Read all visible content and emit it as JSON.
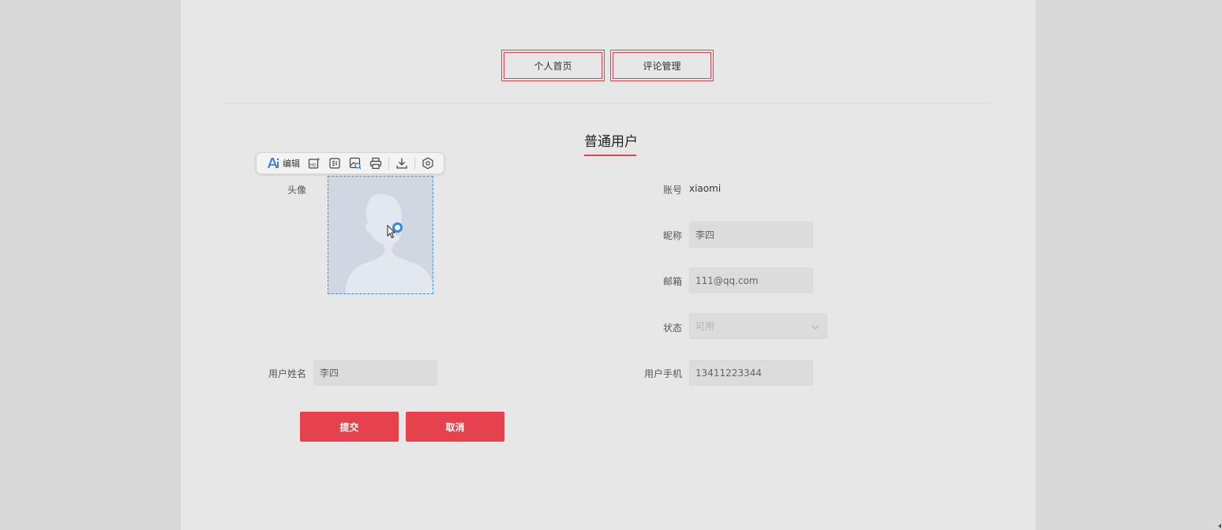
{
  "nav": {
    "home_label": "个人首页",
    "comments_label": "评论管理"
  },
  "section": {
    "title": "普通用户"
  },
  "image_toolbar": {
    "edit_label": "编辑",
    "icons": [
      "ai-edit-icon",
      "hd-icon",
      "ocr-icon",
      "image-search-icon",
      "print-icon",
      "download-icon",
      "settings-icon"
    ]
  },
  "form": {
    "avatar_label": "头像",
    "account_label": "账号",
    "account_value": "xiaomi",
    "nickname_label": "昵称",
    "nickname_value": "李四",
    "email_label": "邮箱",
    "email_value": "111@qq.com",
    "status_label": "状态",
    "status_value": "可用",
    "username_label": "用户姓名",
    "username_value": "李四",
    "phone_label": "用户手机",
    "phone_value": "13411223344"
  },
  "actions": {
    "submit_label": "提交",
    "cancel_label": "取消"
  },
  "colors": {
    "accent": "#e5424d",
    "page_bg": "#e8e7e8",
    "outer_bg": "#d9d9d9",
    "selection_blue": "#2f8ae4"
  }
}
